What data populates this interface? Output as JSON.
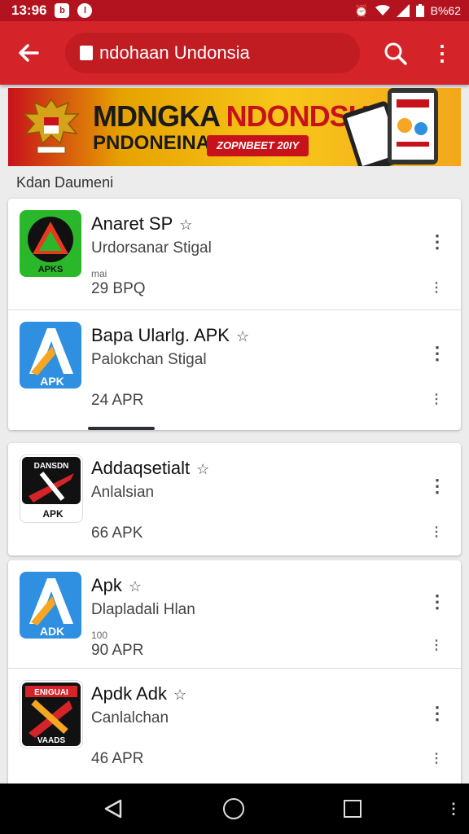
{
  "statusbar": {
    "time": "13:96",
    "battery": "B%62",
    "icon1": "b",
    "icon2": "l"
  },
  "search": {
    "query": "ndohaan Undonsia"
  },
  "banner": {
    "title_black": "MDNGKA ",
    "title_red": "NDONDSIA",
    "subtitle": "PNDONEINA",
    "subtitle_mark": "⚠",
    "badge": "ZOPNBEET 20IY"
  },
  "section": {
    "label": "Kdan Daumeni"
  },
  "apps": [
    {
      "title": "Anaret SP",
      "subtitle": "Urdorsanar Stigal",
      "note": "mai",
      "size": "29 BPQ",
      "icon_text": "APKS",
      "colors": {
        "bg": "#2ab82a",
        "accent": "#e63a1f"
      }
    },
    {
      "title": "Bapa Ularlg. APK",
      "subtitle": "Palokchan Stigal",
      "note": "",
      "size": "24 APR",
      "icon_text": "APK",
      "colors": {
        "bg": "#2f8fe0",
        "accent": "#f5a623"
      }
    },
    {
      "title": "Addaqsetialt",
      "subtitle": "Anlalsian",
      "note": "",
      "size": "66 APK",
      "icon_text": "APK",
      "top_text": "DANSDN",
      "colors": {
        "bg": "#111111",
        "accent": "#d4242a"
      }
    },
    {
      "title": "Apk",
      "subtitle": "Dlapladali Hlan",
      "note": "100",
      "size": "90 APR",
      "icon_text": "ADK",
      "colors": {
        "bg": "#2f8fe0",
        "accent": "#f5a623"
      }
    },
    {
      "title": "Apdk Adk",
      "subtitle": "Canlalchan",
      "note": "",
      "size": "46 APR",
      "icon_text": "VAADS",
      "top_text": "ENIGUAI",
      "colors": {
        "bg": "#111111",
        "accent": "#d4242a"
      }
    }
  ],
  "colors": {
    "appbar": "#d4242a",
    "statusbar": "#b3131f"
  },
  "icons": [
    "back-arrow-icon",
    "search-icon",
    "more-vert-icon",
    "star-outline-icon",
    "nav-back-icon",
    "nav-home-icon",
    "nav-recents-icon"
  ]
}
